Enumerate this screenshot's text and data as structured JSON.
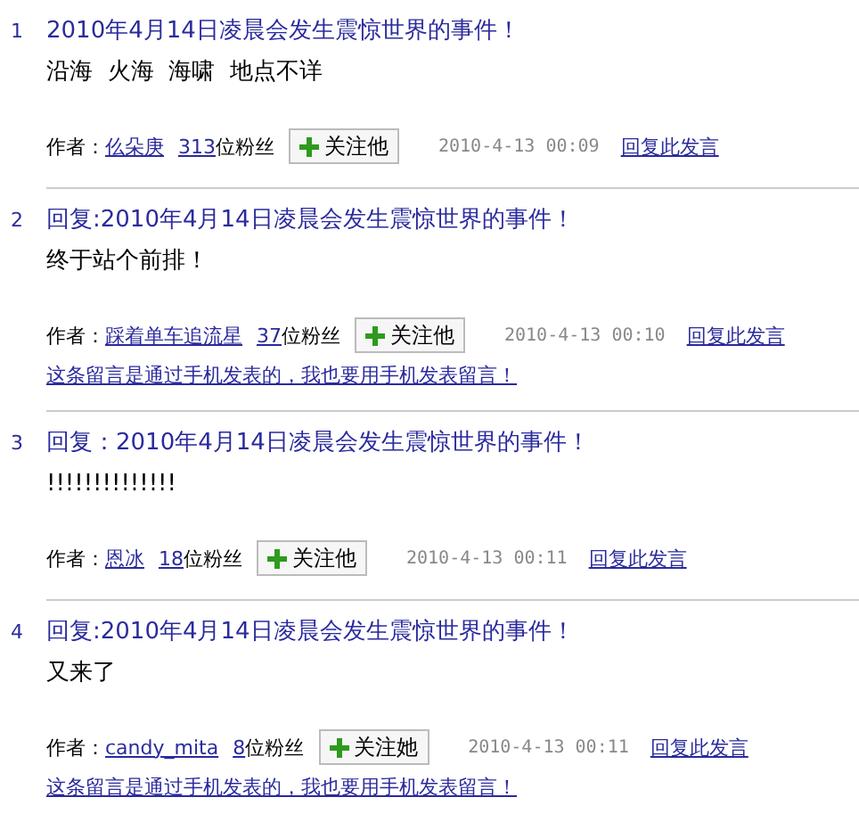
{
  "posts": [
    {
      "number": "1",
      "title": "2010年4月14日凌晨会发生震惊世界的事件！",
      "body": "沿海  火海  海啸  地点不详",
      "author_label": "作者：",
      "author": "仫朵庚",
      "followers_count": "313",
      "followers_label": "位粉丝",
      "follow_button": "关注他",
      "time": "2010-4-13 00:09",
      "reply_link": "回复此发言"
    },
    {
      "number": "2",
      "title": "回复:2010年4月14日凌晨会发生震惊世界的事件！",
      "body": "终于站个前排！",
      "author_label": "作者：",
      "author": "踩着单车追流星",
      "followers_count": "37",
      "followers_label": "位粉丝",
      "follow_button": "关注他",
      "time": "2010-4-13 00:10",
      "reply_link": "回复此发言",
      "mobile_link": "这条留言是通过手机发表的，我也要用手机发表留言！"
    },
    {
      "number": "3",
      "title": "回复：2010年4月14日凌晨会发生震惊世界的事件！",
      "body": "!!!!!!!!!!!!!!",
      "author_label": "作者：",
      "author": "恩冰",
      "followers_count": "18",
      "followers_label": "位粉丝",
      "follow_button": "关注他",
      "time": "2010-4-13 00:11",
      "reply_link": "回复此发言"
    },
    {
      "number": "4",
      "title": "回复:2010年4月14日凌晨会发生震惊世界的事件！",
      "body": "又来了",
      "author_label": "作者：",
      "author": "candy_mita",
      "followers_count": "8",
      "followers_label": "位粉丝",
      "follow_button": "关注她",
      "time": "2010-4-13 00:11",
      "reply_link": "回复此发言",
      "mobile_link": "这条留言是通过手机发表的，我也要用手机发表留言！"
    }
  ]
}
